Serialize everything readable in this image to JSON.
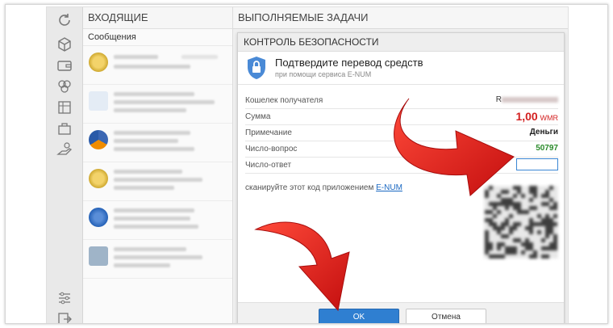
{
  "inbox": {
    "title": "ВХОДЯЩИЕ",
    "subtitle": "Сообщения",
    "messages": [
      {
        "avatar": "gold-coin-icon"
      },
      {
        "avatar": "document-icon"
      },
      {
        "avatar": "social-network-icon"
      },
      {
        "avatar": "gold-coin-icon"
      },
      {
        "avatar": "webmoney-globe-icon"
      },
      {
        "avatar": "cash-register-icon"
      }
    ]
  },
  "tasks": {
    "title": "ВЫПОЛНЯЕМЫЕ ЗАДАЧИ"
  },
  "dialog": {
    "title": "КОНТРОЛЬ БЕЗОПАСНОСТИ",
    "heading": "Подтвердите перевод средств",
    "subheading": "при помощи сервиса E-NUM",
    "rows": {
      "recipient_label": "Кошелек получателя",
      "recipient_value": "R",
      "amount_label": "Сумма",
      "amount_value": "1,00",
      "amount_currency": "WMR",
      "note_label": "Примечание",
      "note_value": "Деньги",
      "question_label": "Число-вопрос",
      "question_value": "50797",
      "answer_label": "Число-ответ",
      "answer_value": ""
    },
    "scan_text": "сканируйте этот код приложением ",
    "scan_link": "E-NUM",
    "ok_label": "OK",
    "cancel_label": "Отмена"
  },
  "colors": {
    "accent_blue": "#2f7fd1",
    "amount_red": "#d32020",
    "question_green": "#2a8a2a",
    "arrow_red": "#e01818"
  }
}
